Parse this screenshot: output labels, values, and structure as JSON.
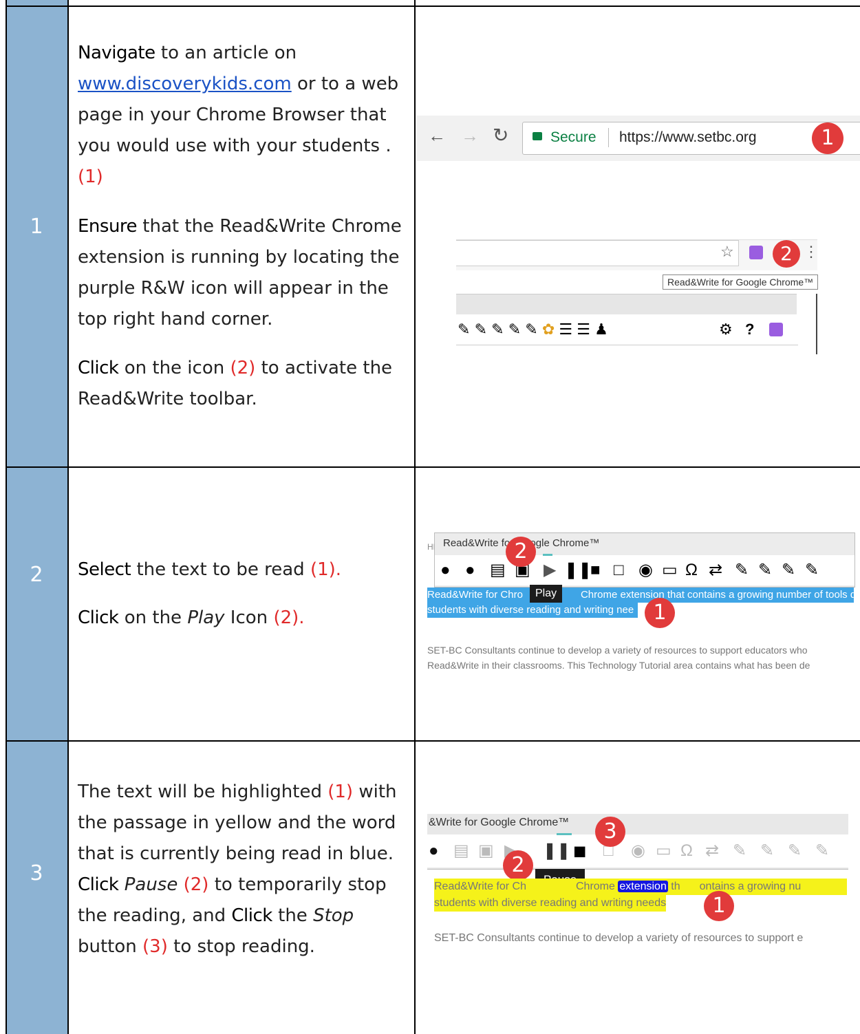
{
  "steps": [
    {
      "number": "1",
      "p1": {
        "kw": "Navigate",
        "t1": " to an article on ",
        "link": "www.discoverykids.com",
        "t2": " or to a web page in your Chrome Browser that you would use with your students . ",
        "ref": "(1)"
      },
      "p2": {
        "kw": "Ensure",
        "t1": " that the Read&Write Chrome extension is running by locating the purple R&W icon will appear in the top right hand corner."
      },
      "p3": {
        "kw": "Click",
        "t1": " on the icon ",
        "ref": "(2)",
        "t2": " to activate the Read&Write toolbar."
      },
      "shot_a": {
        "secure": "Secure",
        "url": "https://www.setbc.org",
        "badge": "1"
      },
      "shot_b": {
        "tooltip": "Read&Write for Google Chrome™",
        "badge": "2"
      }
    },
    {
      "number": "2",
      "p1": {
        "kw": "Select",
        "t1": " the text to be read ",
        "ref": "(1)."
      },
      "p2": {
        "kw": "Click",
        "t1": " on the ",
        "em": "Play",
        "t2": " Icon ",
        "ref": "(2)."
      },
      "shot": {
        "header": "Read&Write for Google Chrome™",
        "hnc": "HNC",
        "tooltip": "Play",
        "sel_line1": "Read&Write for Chro",
        "sel_line1b": "Chrome extension that contains a growing number of tools d",
        "sel_line2": "students with diverse reading and writing nee",
        "gray1": "SET-BC Consultants continue to develop a variety of resources to support educators who",
        "gray2": "Read&Write in their classrooms. This Technology Tutorial area contains what has been de",
        "badge1": "1",
        "badge2": "2"
      }
    },
    {
      "number": "3",
      "p1": {
        "t0": "The text will be highlighted ",
        "ref": "(1)",
        "t1": " with the passage in yellow and the word that is currently being read in blue."
      },
      "p2": {
        "kw": "Click",
        "em": "Pause",
        "ref": "(2)",
        "t1": " to temporarily stop the reading, and ",
        "kw2": "Click",
        "t2": " the ",
        "em2": "Stop",
        "t3": " button ",
        "ref2": "(3)",
        "t4": " to stop reading."
      },
      "shot": {
        "header": "&Write for Google Chrome™",
        "tooltip": "Pause",
        "hl1a": "Read&Write for Ch",
        "hl1b": "Chrome",
        "word": "extension",
        "hl1c": "th",
        "hl1d": "ontains a growing nu",
        "hl2": "students with diverse reading and writing needs",
        "gray": "SET-BC Consultants continue to develop a variety of resources to support e",
        "badge1": "1",
        "badge2": "2",
        "badge3": "3"
      }
    }
  ]
}
